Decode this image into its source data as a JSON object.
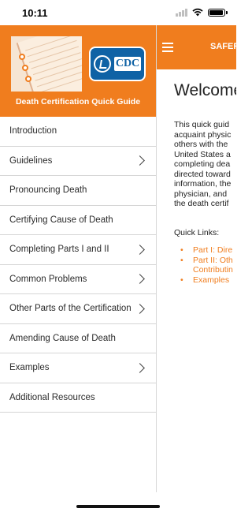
{
  "status_bar": {
    "time": "10:11"
  },
  "drawer": {
    "title": "Death Certification Quick Guide",
    "logo_text": "CDC",
    "items": [
      {
        "label": "Introduction",
        "has_chevron": false
      },
      {
        "label": "Guidelines",
        "has_chevron": true
      },
      {
        "label": "Pronouncing Death",
        "has_chevron": false
      },
      {
        "label": "Certifying Cause of Death",
        "has_chevron": false
      },
      {
        "label": "Completing Parts I and II",
        "has_chevron": true
      },
      {
        "label": "Common Problems",
        "has_chevron": true
      },
      {
        "label": "Other Parts of the Certification",
        "has_chevron": true
      },
      {
        "label": "Amending Cause of Death",
        "has_chevron": false
      },
      {
        "label": "Examples",
        "has_chevron": true
      },
      {
        "label": "Additional Resources",
        "has_chevron": false
      }
    ]
  },
  "main": {
    "nav_title": "SAFER",
    "welcome": "Welcome",
    "intro_lines": [
      "This quick guid",
      "acquaint physic",
      "others with the",
      "United States a",
      "completing dea",
      "directed toward",
      "information, the",
      "physician, and",
      "the death certif"
    ],
    "quick_links_label": "Quick Links:",
    "links": [
      {
        "lines": [
          "Part I: Dire"
        ]
      },
      {
        "lines": [
          "Part II: Oth",
          "Contributin"
        ]
      },
      {
        "lines": [
          "Examples"
        ]
      }
    ]
  },
  "colors": {
    "accent": "#f07d1e",
    "cdc_blue": "#0f62a5"
  }
}
